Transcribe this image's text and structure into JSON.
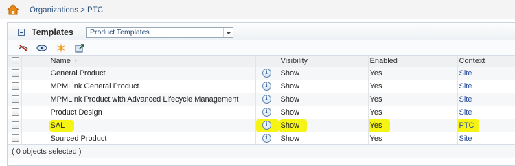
{
  "breadcrumb": {
    "text": "Organizations > PTC"
  },
  "panel": {
    "title": "Templates",
    "select_value": "Product Templates"
  },
  "toolbar": {
    "icons": [
      "hide-icon",
      "view-icon",
      "new-icon",
      "export-icon"
    ]
  },
  "table": {
    "columns": [
      "Name",
      "Visibility",
      "Enabled",
      "Context"
    ],
    "sort_indicator": "↑",
    "rows": [
      {
        "name": "General Product",
        "visibility": "Show",
        "enabled": "Yes",
        "context": "Site"
      },
      {
        "name": "MPMLink General Product",
        "visibility": "Show",
        "enabled": "Yes",
        "context": "Site"
      },
      {
        "name": "MPMLink Product with Advanced Lifecycle Management",
        "visibility": "Show",
        "enabled": "Yes",
        "context": "Site"
      },
      {
        "name": "Product Design",
        "visibility": "Show",
        "enabled": "Yes",
        "context": "Site"
      },
      {
        "name": "SAL",
        "visibility": "Show",
        "enabled": "Yes",
        "context": "PTC"
      },
      {
        "name": "Sourced Product",
        "visibility": "Show",
        "enabled": "Yes",
        "context": "Site"
      }
    ]
  },
  "footer": {
    "selection_text": "( 0 objects selected )"
  },
  "colors": {
    "highlight": "#f4f300",
    "link": "#2a4f9d",
    "breadcrumb": "#2a4f7d"
  }
}
